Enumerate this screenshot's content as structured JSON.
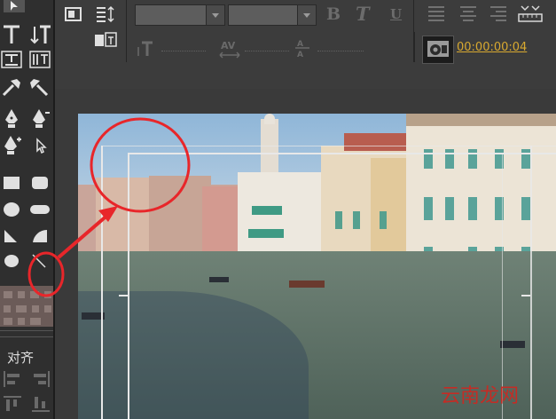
{
  "toolbar": {
    "font_name_value": "",
    "font_size_value": "",
    "bold_label": "B",
    "italic_label": "T",
    "underline_label": "U",
    "timecode": "00:00:00:04"
  },
  "toolbox": {
    "align_label": "对齐"
  },
  "watermark": "云南龙网",
  "colors": {
    "annotation_red": "#e8262a",
    "timecode": "#d8a930",
    "panel_dark": "#2f2f2f",
    "toolbar_bg": "#3c3c3c"
  },
  "icons": [
    "select-arrow-icon",
    "text-tool-icon",
    "vertical-text-tool-icon",
    "text-box-icon",
    "vertical-text-box-icon",
    "hammer-icon",
    "hammer-alt-icon",
    "pen-tool-icon",
    "pen-minus-icon",
    "pen-plus-icon",
    "direct-select-icon",
    "rectangle-icon",
    "rounded-rectangle-icon",
    "ellipse-icon",
    "pill-icon",
    "triangle-icon",
    "quarter-circle-icon",
    "circle-icon",
    "line-tool-icon",
    "texture-swatch-icon",
    "align-left-icon",
    "align-right-icon",
    "title-icon",
    "line-spacing-icon",
    "text-style-icon",
    "text-justify-icon",
    "text-center-icon",
    "text-right-icon",
    "tab-ruler-icon",
    "text-baseline-icon",
    "kerning-icon",
    "leading-icon",
    "render-preview-icon"
  ]
}
